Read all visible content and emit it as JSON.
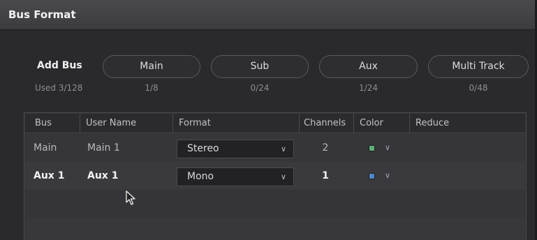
{
  "window": {
    "title": "Bus Format"
  },
  "add_bus": {
    "label": "Add Bus",
    "used": "Used 3/128",
    "buttons": [
      {
        "label": "Main",
        "count": "1/8"
      },
      {
        "label": "Sub",
        "count": "0/24"
      },
      {
        "label": "Aux",
        "count": "1/24"
      },
      {
        "label": "Multi Track",
        "count": "0/48"
      }
    ]
  },
  "table": {
    "headers": [
      "Bus",
      "User Name",
      "Format",
      "Channels",
      "Color",
      "Reduce"
    ],
    "rows": [
      {
        "bus": "Main",
        "user_name": "Main 1",
        "format": "Stereo",
        "channels": "2",
        "color": "#5fae7a",
        "color_name": "green"
      },
      {
        "bus": "Aux 1",
        "user_name": "Aux 1",
        "format": "Mono",
        "channels": "1",
        "color": "#4d86c8",
        "color_name": "blue"
      }
    ]
  },
  "icons": {
    "dropdown_chevron": "chevron-down-icon",
    "cursor": "mouse-pointer-icon"
  }
}
